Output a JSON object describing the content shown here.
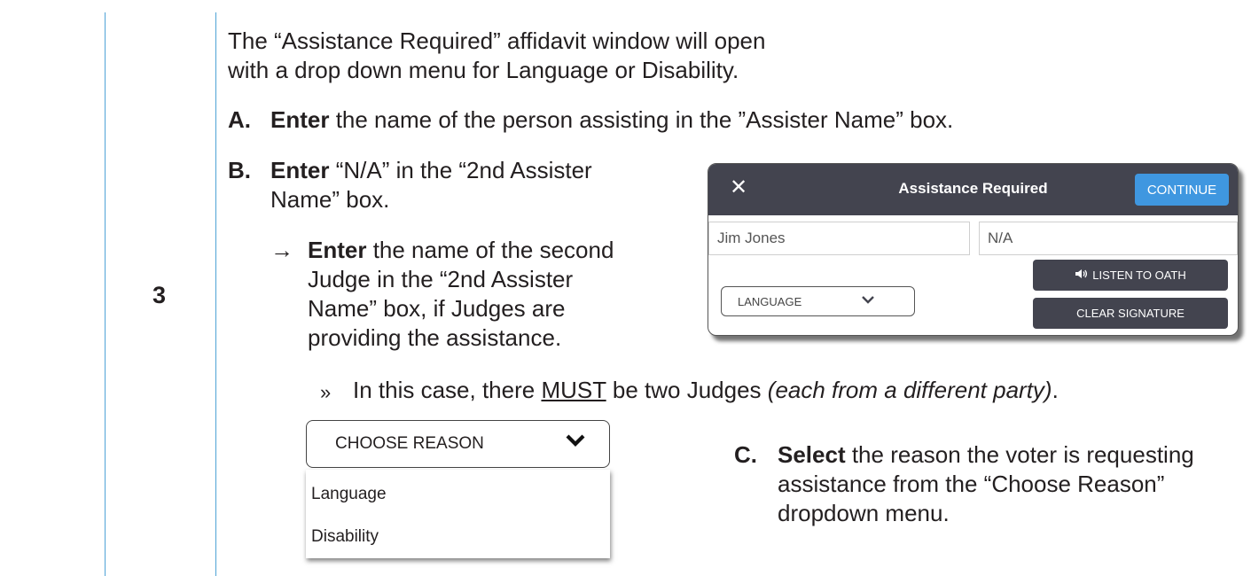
{
  "step": {
    "number": "3"
  },
  "intro": "The “Assistance Required” affidavit window will open with a drop down menu for Language or Disability.",
  "steps": {
    "a": {
      "marker": "A.",
      "bold": "Enter",
      "text": " the name of the person assisting in the ”Assister Name” box."
    },
    "b": {
      "marker": "B.",
      "bold": "Enter",
      "text1": " “N/A” in the “2nd Assister",
      "text2": "Name” box."
    },
    "arrow": {
      "symbol": "→",
      "bold": "Enter",
      "line1": " the name of the second",
      "line2": "Judge in the “2nd Assister",
      "line3": "Name” box, if Judges are",
      "line4": "providing the assistance."
    },
    "note": {
      "symbol": "»",
      "pre": "In this case, there ",
      "emph": "MUST",
      "mid": " be two Judges ",
      "italic": "(each from a different party)",
      "post": "."
    },
    "c": {
      "marker": "C.",
      "bold": "Select",
      "line1": " the reason the voter is requesting",
      "line2": "assistance from the “Choose Reason”",
      "line3": "dropdown menu."
    }
  },
  "window": {
    "title": "Assistance Required",
    "close_icon": "close-icon",
    "continue_label": "CONTINUE",
    "assister_name": "Jim Jones",
    "second_assister_name": "N/A",
    "language_dropdown": "LANGUAGE",
    "listen_label": "LISTEN TO OATH",
    "clear_label": "CLEAR SIGNATURE",
    "header_color": "#43444f",
    "accent_color": "#3f97e0"
  },
  "reason_dropdown": {
    "label": "CHOOSE REASON",
    "options": [
      "Language",
      "Disability"
    ]
  }
}
